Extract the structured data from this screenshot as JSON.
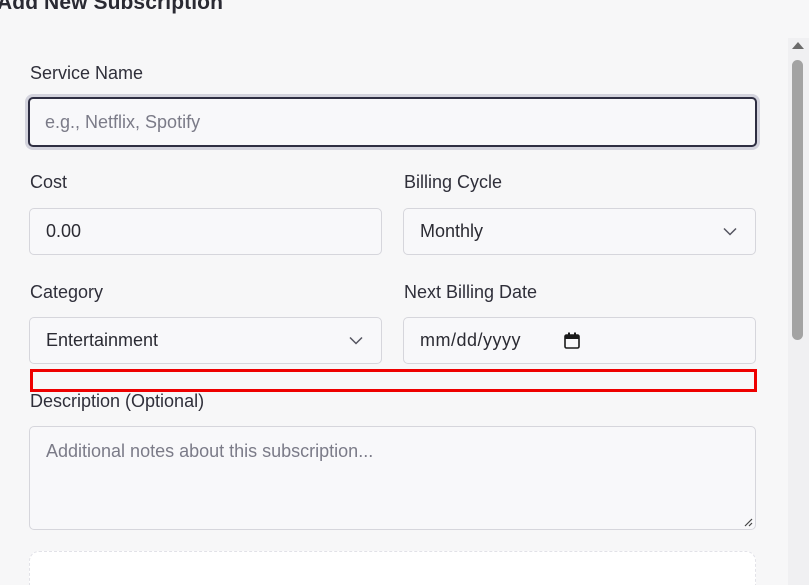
{
  "dialog": {
    "title": "Add New Subscription"
  },
  "form": {
    "service_name": {
      "label": "Service Name",
      "value": "",
      "placeholder": "e.g., Netflix, Spotify"
    },
    "cost": {
      "label": "Cost",
      "value": "0.00"
    },
    "billing_cycle": {
      "label": "Billing Cycle",
      "selected": "Monthly"
    },
    "category": {
      "label": "Category",
      "selected": "Entertainment"
    },
    "next_billing_date": {
      "label": "Next Billing Date",
      "value": "mm/dd/yyyy"
    },
    "description": {
      "label": "Description (Optional)",
      "value": "",
      "placeholder": "Additional notes about this subscription..."
    }
  },
  "icons": {
    "select_arrow": "chevron-down-icon",
    "date_picker": "calendar-icon",
    "resize": "resize-grip-icon",
    "scroll_up": "scroll-up-arrow-icon"
  },
  "colors": {
    "highlight": "#ee0000",
    "focus_border": "#2e2e42",
    "placeholder": "#7b7b88",
    "background": "#f7f7f8"
  }
}
